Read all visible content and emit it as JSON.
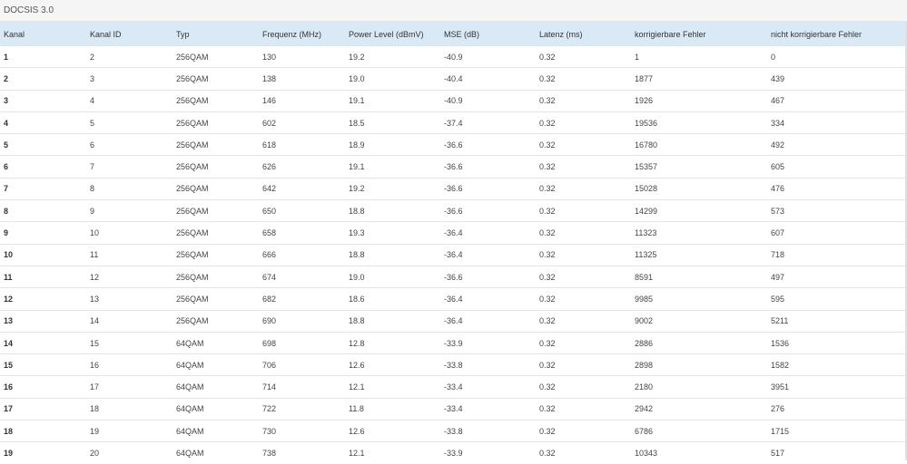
{
  "section": {
    "title": "DOCSIS 3.0"
  },
  "table": {
    "columns": [
      "Kanal",
      "Kanal ID",
      "Typ",
      "Frequenz (MHz)",
      "Power Level (dBmV)",
      "MSE (dB)",
      "Latenz (ms)",
      "korrigierbare Fehler",
      "nicht korrigierbare Fehler"
    ],
    "rows": [
      [
        "1",
        "2",
        "256QAM",
        "130",
        "19.2",
        "-40.9",
        "0.32",
        "1",
        "0"
      ],
      [
        "2",
        "3",
        "256QAM",
        "138",
        "19.0",
        "-40.4",
        "0.32",
        "1877",
        "439"
      ],
      [
        "3",
        "4",
        "256QAM",
        "146",
        "19.1",
        "-40.9",
        "0.32",
        "1926",
        "467"
      ],
      [
        "4",
        "5",
        "256QAM",
        "602",
        "18.5",
        "-37.4",
        "0.32",
        "19536",
        "334"
      ],
      [
        "5",
        "6",
        "256QAM",
        "618",
        "18.9",
        "-36.6",
        "0.32",
        "16780",
        "492"
      ],
      [
        "6",
        "7",
        "256QAM",
        "626",
        "19.1",
        "-36.6",
        "0.32",
        "15357",
        "605"
      ],
      [
        "7",
        "8",
        "256QAM",
        "642",
        "19.2",
        "-36.6",
        "0.32",
        "15028",
        "476"
      ],
      [
        "8",
        "9",
        "256QAM",
        "650",
        "18.8",
        "-36.6",
        "0.32",
        "14299",
        "573"
      ],
      [
        "9",
        "10",
        "256QAM",
        "658",
        "19.3",
        "-36.4",
        "0.32",
        "11323",
        "607"
      ],
      [
        "10",
        "11",
        "256QAM",
        "666",
        "18.8",
        "-36.4",
        "0.32",
        "11325",
        "718"
      ],
      [
        "11",
        "12",
        "256QAM",
        "674",
        "19.0",
        "-36.6",
        "0.32",
        "8591",
        "497"
      ],
      [
        "12",
        "13",
        "256QAM",
        "682",
        "18.6",
        "-36.4",
        "0.32",
        "9985",
        "595"
      ],
      [
        "13",
        "14",
        "256QAM",
        "690",
        "18.8",
        "-36.4",
        "0.32",
        "9002",
        "5211"
      ],
      [
        "14",
        "15",
        "64QAM",
        "698",
        "12.8",
        "-33.9",
        "0.32",
        "2886",
        "1536"
      ],
      [
        "15",
        "16",
        "64QAM",
        "706",
        "12.6",
        "-33.8",
        "0.32",
        "2898",
        "1582"
      ],
      [
        "16",
        "17",
        "64QAM",
        "714",
        "12.1",
        "-33.4",
        "0.32",
        "2180",
        "3951"
      ],
      [
        "17",
        "18",
        "64QAM",
        "722",
        "11.8",
        "-33.4",
        "0.32",
        "2942",
        "276"
      ],
      [
        "18",
        "19",
        "64QAM",
        "730",
        "12.6",
        "-33.8",
        "0.32",
        "6786",
        "1715"
      ],
      [
        "19",
        "20",
        "64QAM",
        "738",
        "12.1",
        "-33.9",
        "0.32",
        "10343",
        "517"
      ]
    ]
  }
}
